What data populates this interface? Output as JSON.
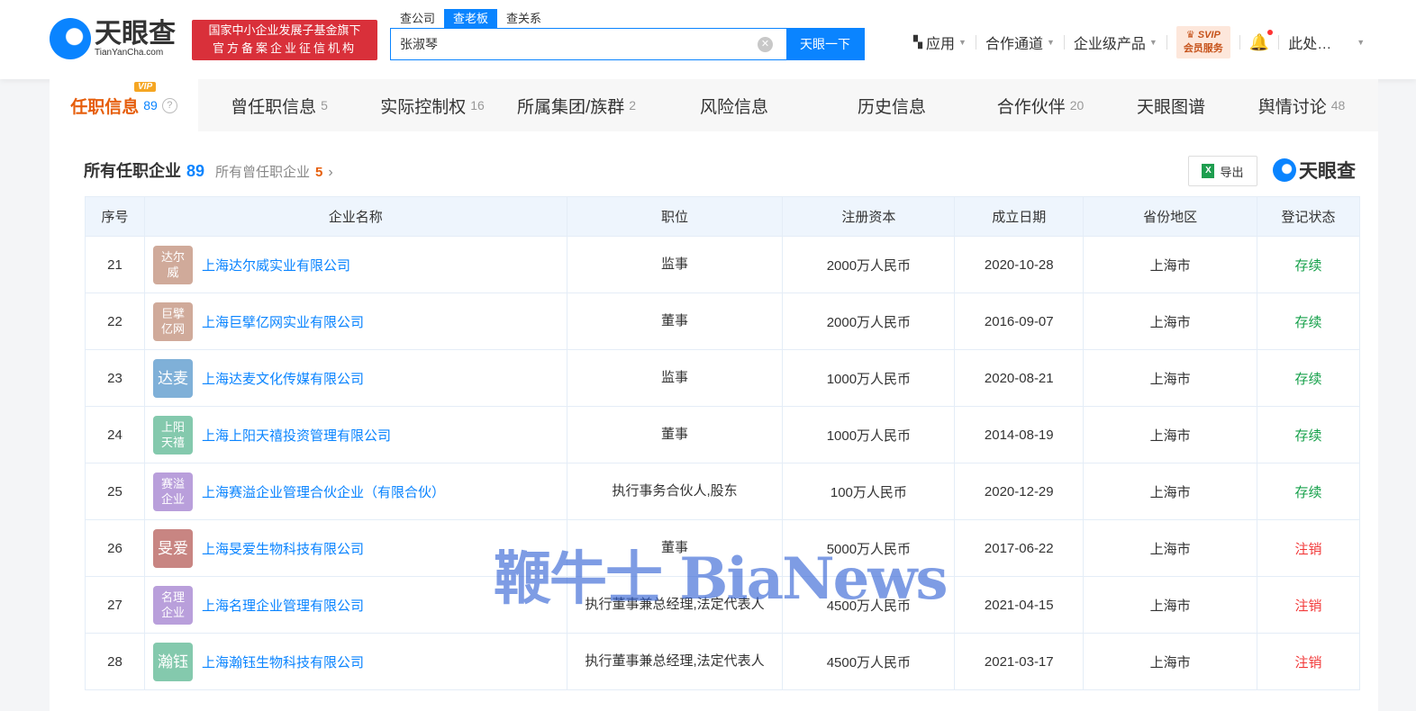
{
  "header": {
    "logo_cn": "天眼查",
    "logo_en": "TianYanCha.com",
    "banner_line1": "国家中小企业发展子基金旗下",
    "banner_line2": "官方备案企业征信机构",
    "search_tabs": [
      "查公司",
      "查老板",
      "查关系"
    ],
    "search_value": "张淑琴",
    "search_button": "天眼一下",
    "nav": [
      "应用",
      "合作通道",
      "企业级产品"
    ],
    "svip_top": "SVIP",
    "svip_bottom": "会员服务",
    "user": "此处…"
  },
  "tabs": [
    {
      "label": "任职信息",
      "count": "89",
      "vip": "VIP"
    },
    {
      "label": "曾任职信息",
      "count": "5"
    },
    {
      "label": "实际控制权",
      "count": "16"
    },
    {
      "label": "所属集团/族群",
      "count": "2"
    },
    {
      "label": "风险信息",
      "count": ""
    },
    {
      "label": "历史信息",
      "count": ""
    },
    {
      "label": "合作伙伴",
      "count": "20"
    },
    {
      "label": "天眼图谱",
      "count": ""
    },
    {
      "label": "舆情讨论",
      "count": "48"
    }
  ],
  "section": {
    "title": "所有任职企业",
    "count": "89",
    "alt_title": "所有曾任职企业",
    "alt_count": "5",
    "export": "导出",
    "brand": "天眼查"
  },
  "table": {
    "headers": [
      "序号",
      "企业名称",
      "职位",
      "注册资本",
      "成立日期",
      "省份地区",
      "登记状态"
    ],
    "rows": [
      {
        "no": "21",
        "badge": "达尔威",
        "badge_color": "#d0aa9a",
        "name": "上海达尔威实业有限公司",
        "position": "监事",
        "capital": "2000万人民币",
        "date": "2020-10-28",
        "region": "上海市",
        "status": "存续"
      },
      {
        "no": "22",
        "badge": "巨擘亿网",
        "badge_color": "#d0aa9a",
        "name": "上海巨擘亿网实业有限公司",
        "position": "董事",
        "capital": "2000万人民币",
        "date": "2016-09-07",
        "region": "上海市",
        "status": "存续"
      },
      {
        "no": "23",
        "badge": "达麦",
        "badge_color": "#7fb0d8",
        "name": "上海达麦文化传媒有限公司",
        "position": "监事",
        "capital": "1000万人民币",
        "date": "2020-08-21",
        "region": "上海市",
        "status": "存续"
      },
      {
        "no": "24",
        "badge": "上阳天禧",
        "badge_color": "#84c9ad",
        "name": "上海上阳天禧投资管理有限公司",
        "position": "董事",
        "capital": "1000万人民币",
        "date": "2014-08-19",
        "region": "上海市",
        "status": "存续"
      },
      {
        "no": "25",
        "badge": "赛溢企业",
        "badge_color": "#b99fdb",
        "name": "上海赛溢企业管理合伙企业（有限合伙）",
        "position": "执行事务合伙人,股东",
        "capital": "100万人民币",
        "date": "2020-12-29",
        "region": "上海市",
        "status": "存续"
      },
      {
        "no": "26",
        "badge": "旻爱",
        "badge_color": "#c88582",
        "name": "上海旻爱生物科技有限公司",
        "position": "董事",
        "capital": "5000万人民币",
        "date": "2017-06-22",
        "region": "上海市",
        "status": "注销"
      },
      {
        "no": "27",
        "badge": "名理企业",
        "badge_color": "#b99fdb",
        "name": "上海名理企业管理有限公司",
        "position": "执行董事兼总经理,法定代表人",
        "capital": "4500万人民币",
        "date": "2021-04-15",
        "region": "上海市",
        "status": "注销"
      },
      {
        "no": "28",
        "badge": "瀚钰",
        "badge_color": "#84c9ad",
        "name": "上海瀚钰生物科技有限公司",
        "position": "执行董事兼总经理,法定代表人",
        "capital": "4500万人民币",
        "date": "2021-03-17",
        "region": "上海市",
        "status": "注销"
      }
    ]
  },
  "watermark": "鞭牛士 BiaNews"
}
